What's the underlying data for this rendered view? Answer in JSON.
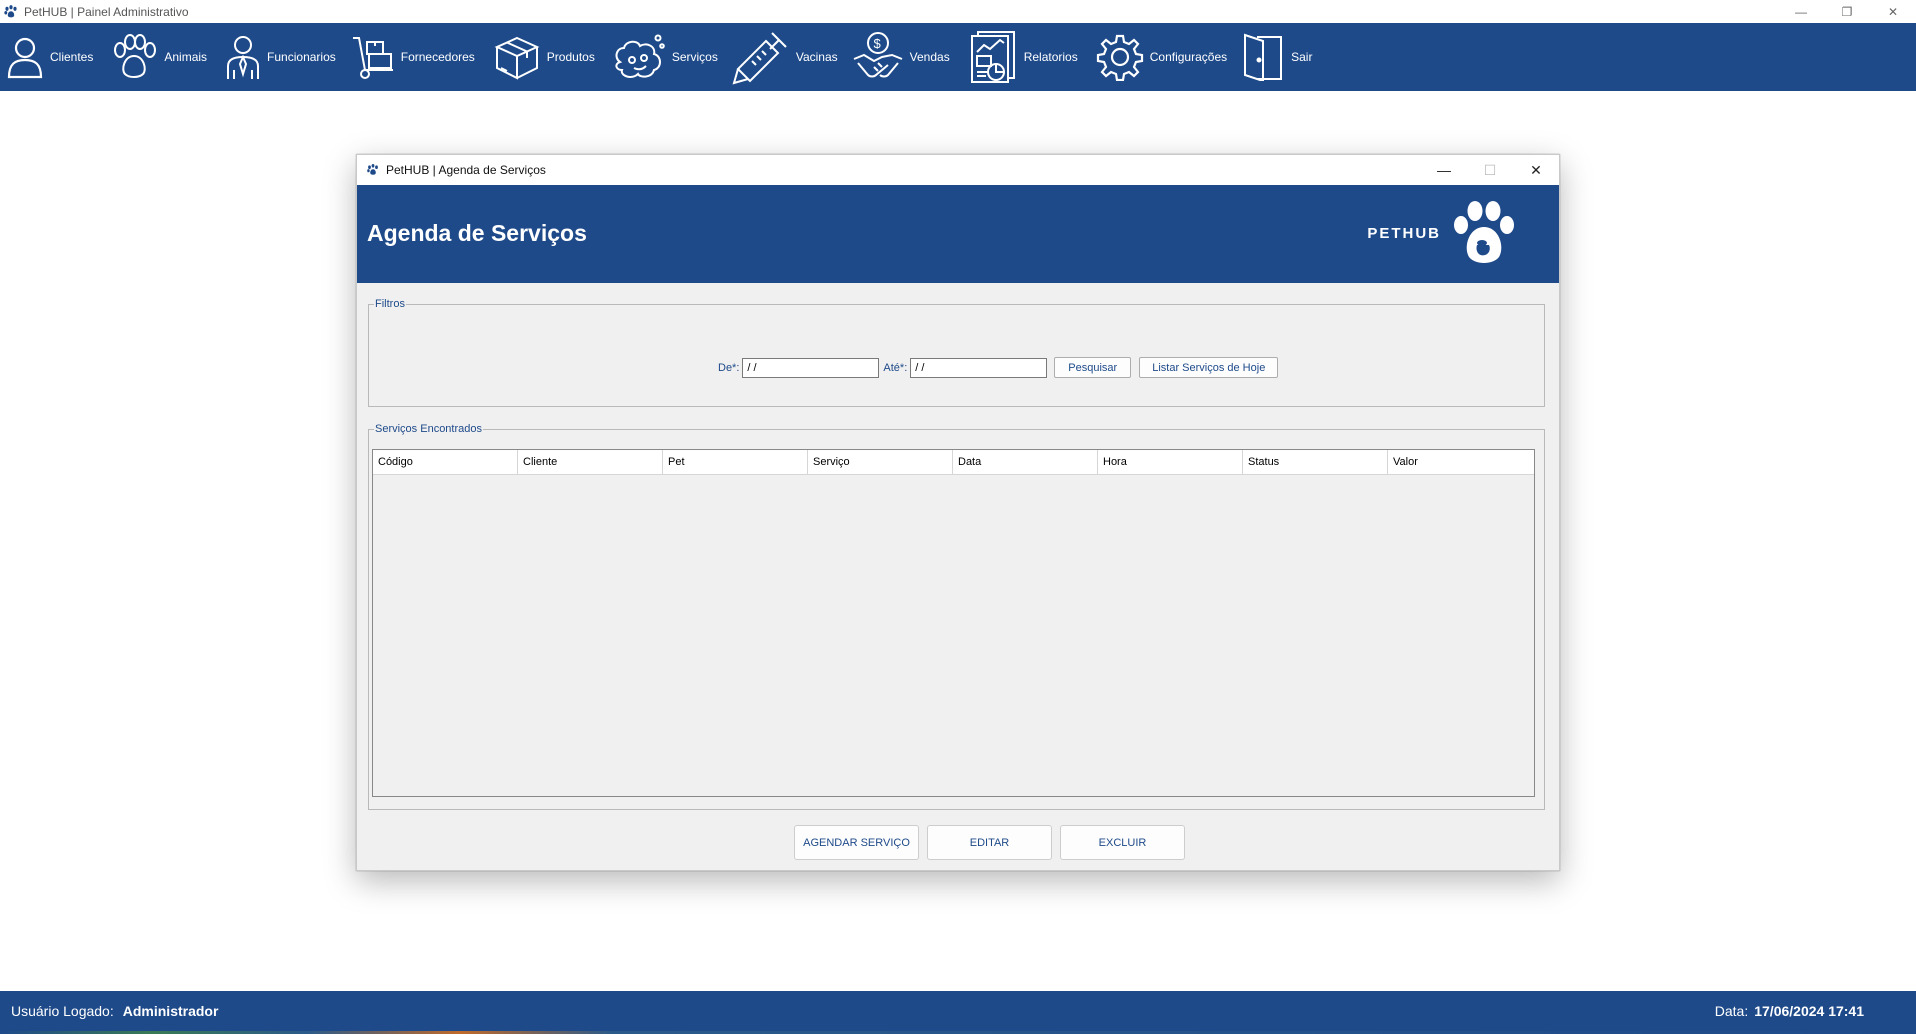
{
  "window": {
    "title": "PetHUB | Painel Administrativo",
    "minimize_glyph": "—",
    "restore_glyph": "❐",
    "close_glyph": "✕"
  },
  "toolbar": {
    "items": [
      {
        "label": "Clientes",
        "icon": "user-icon"
      },
      {
        "label": "Animais",
        "icon": "paw-icon"
      },
      {
        "label": "Funcionarios",
        "icon": "employee-icon"
      },
      {
        "label": "Fornecedores",
        "icon": "hand-truck-icon"
      },
      {
        "label": "Produtos",
        "icon": "box-icon"
      },
      {
        "label": "Serviços",
        "icon": "grooming-icon"
      },
      {
        "label": "Vacinas",
        "icon": "syringe-icon"
      },
      {
        "label": "Vendas",
        "icon": "handshake-icon"
      },
      {
        "label": "Relatorios",
        "icon": "report-icon"
      },
      {
        "label": "Configurações",
        "icon": "gear-icon"
      },
      {
        "label": "Sair",
        "icon": "exit-door-icon"
      }
    ]
  },
  "dialog": {
    "title": "PetHUB | Agenda de Serviços",
    "minimize_glyph": "—",
    "maximize_glyph": "☐",
    "close_glyph": "✕",
    "header_title": "Agenda de Serviços",
    "brand": "PETHUB",
    "filters": {
      "legend": "Filtros",
      "from_label": "De*:",
      "from_value": "/ /",
      "to_label": "Até*:",
      "to_value": "/ /",
      "search_button": "Pesquisar",
      "today_button": "Listar Serviços de Hoje"
    },
    "results": {
      "legend": "Serviços Encontrados",
      "columns": [
        "Código",
        "Cliente",
        "Pet",
        "Serviço",
        "Data",
        "Hora",
        "Status",
        "Valor"
      ],
      "rows": []
    },
    "actions": {
      "schedule": "AGENDAR SERVIÇO",
      "edit": "EDITAR",
      "delete": "EXCLUIR"
    }
  },
  "status": {
    "user_label": "Usuário Logado:",
    "user_value": "Administrador",
    "date_label": "Data:",
    "date_value": "17/06/2024 17:41"
  },
  "colors": {
    "primary": "#1e4a8a",
    "dialog_bg": "#f0f0f0"
  }
}
